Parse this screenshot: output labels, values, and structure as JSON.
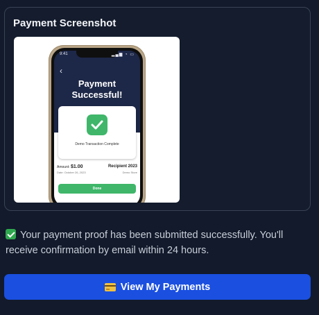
{
  "screenshot_card": {
    "title": "Payment Screenshot",
    "phone": {
      "time": "9:41",
      "status_icons": "▂▄▆ ◔ ▭",
      "back_glyph": "‹",
      "headline_line1": "Payment",
      "headline_line2": "Successful!",
      "transaction_text": "Demo Transaction Complete",
      "amount_label": "Amount:",
      "amount_value": "$1.00",
      "date_text": "Date: October 26, 2023",
      "recipient": "Recipient 2023",
      "recipient_sub": "Demo Store",
      "done_label": "Done"
    }
  },
  "message": {
    "text": "Your payment proof has been submitted successfully. You'll receive confirmation by email within 24 hours."
  },
  "actions": {
    "view_payments_label": "View My Payments"
  },
  "icons": {
    "success": "check-emoji-icon",
    "payments": "credit-card-icon"
  },
  "colors": {
    "background": "#121a2b",
    "primary_button": "#1a4fe0",
    "success_green": "#3fb66a"
  }
}
